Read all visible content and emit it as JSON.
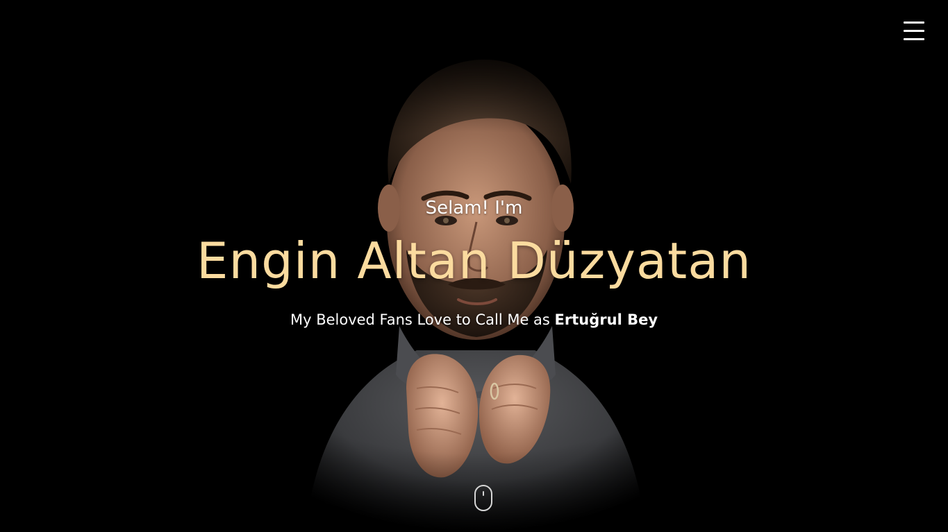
{
  "header": {
    "menu_icon": "hamburger-menu-icon"
  },
  "hero": {
    "greeting": "Selam! I'm",
    "name": "Engin Altan Düzyatan",
    "tagline_prefix": "My Beloved Fans Love to Call Me as",
    "tagline_highlight": "Ertuğrul Bey",
    "portrait_icon": "portrait-photo",
    "scroll_icon": "scroll-down-mouse-icon"
  },
  "colors": {
    "background": "#000000",
    "name_color": "#fbdb9f",
    "text_color": "#ffffff"
  }
}
